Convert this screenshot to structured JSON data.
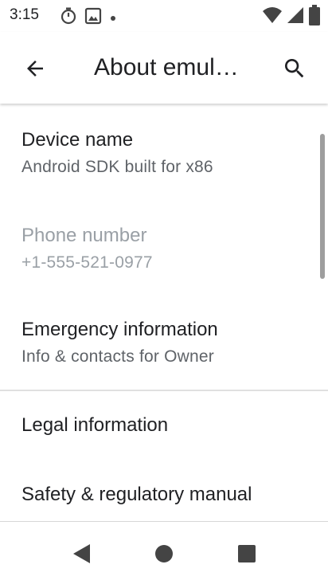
{
  "status_bar": {
    "time": "3:15",
    "icons": [
      "timer-icon",
      "gallery-icon",
      "dot-icon",
      "wifi-icon",
      "cellular-icon",
      "battery-icon"
    ]
  },
  "app_bar": {
    "title": "About emul…",
    "back_icon": "arrow-back-icon",
    "search_icon": "search-icon"
  },
  "list": {
    "items": [
      {
        "title": "Device name",
        "subtitle": "Android SDK built for x86",
        "enabled": true
      },
      {
        "title": "Phone number",
        "subtitle": "+1-555-521-0977",
        "enabled": false
      },
      {
        "title": "Emergency information",
        "subtitle": "Info & contacts for Owner",
        "enabled": true
      },
      {
        "title": "Legal information",
        "subtitle": "",
        "enabled": true
      },
      {
        "title": "Safety & regulatory manual",
        "subtitle": "",
        "enabled": true
      }
    ]
  },
  "nav_bar": {
    "back": "nav-back-icon",
    "home": "nav-home-icon",
    "recents": "nav-recents-icon"
  },
  "colors": {
    "text_primary": "#202124",
    "text_secondary": "#5f6368",
    "text_disabled": "#9aa0a6",
    "nav_icon": "#444444"
  }
}
